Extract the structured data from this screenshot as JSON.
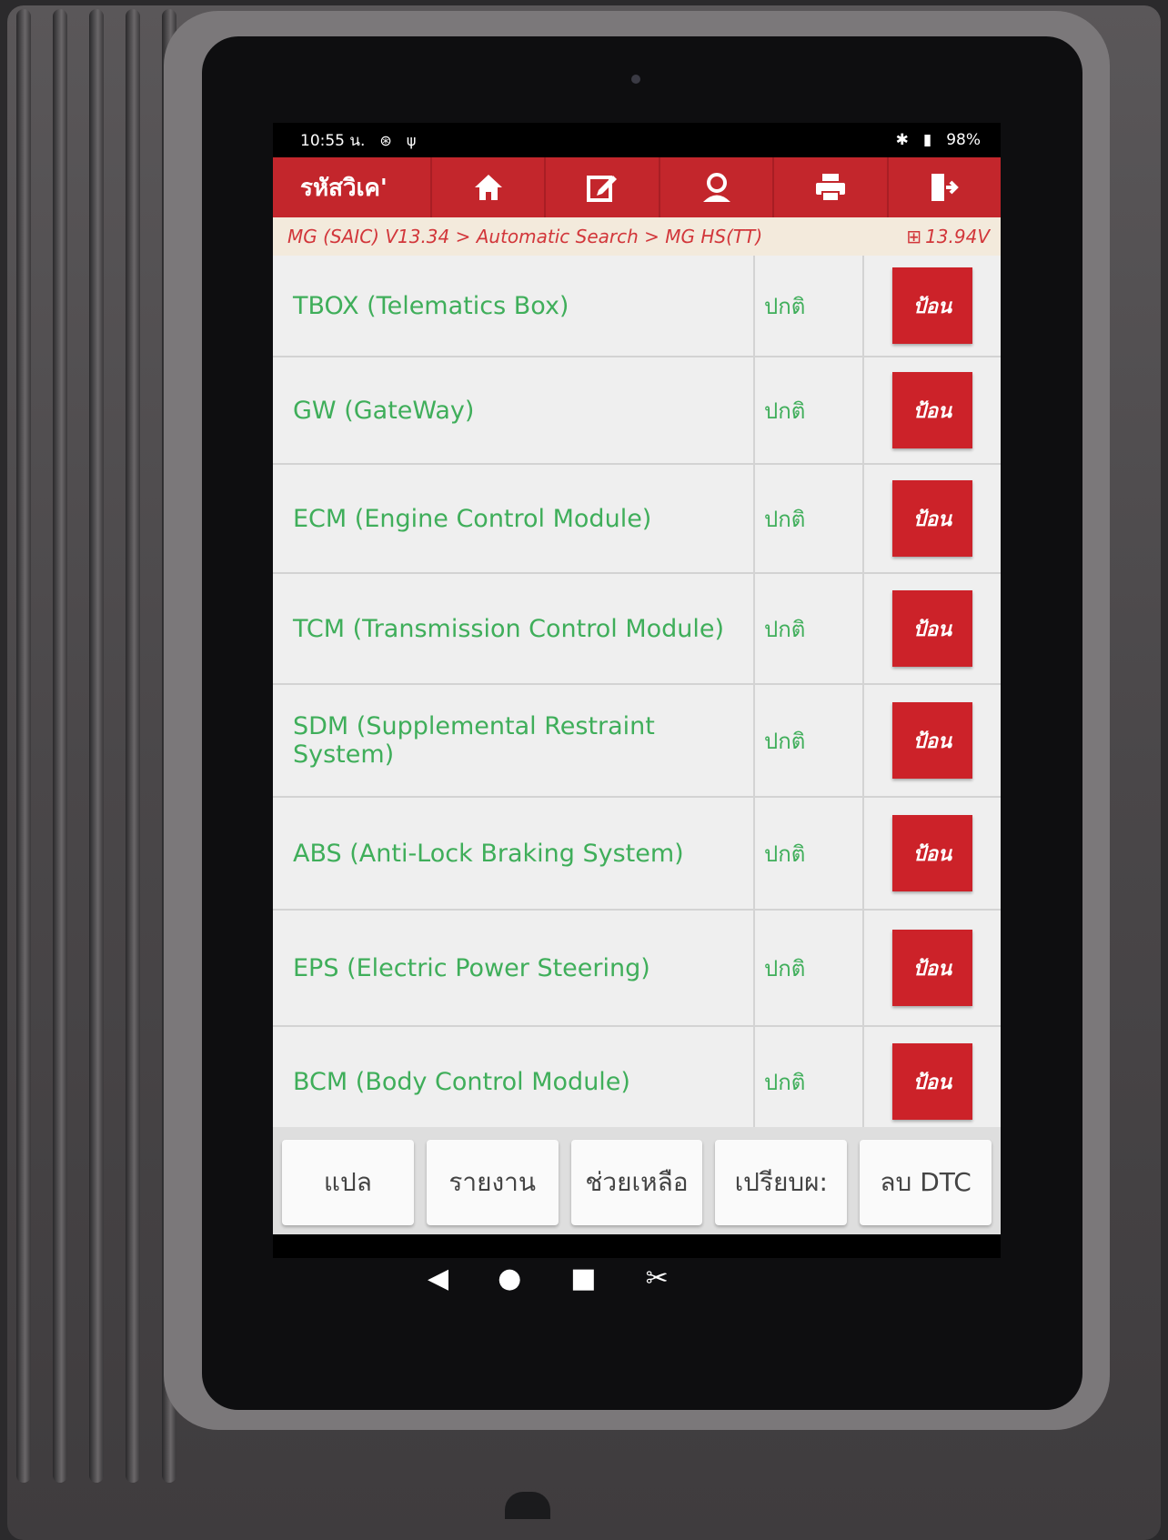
{
  "statusbar": {
    "time": "10:55 น.",
    "battery": "98%"
  },
  "toolbar": {
    "title": "รหัสวิเค'",
    "buttons": [
      "home-icon",
      "edit-icon",
      "user-icon",
      "print-icon",
      "exit-icon"
    ]
  },
  "breadcrumb": {
    "path": "MG (SAIC) V13.34 > Automatic Search > MG HS(TT)",
    "voltage": "13.94V"
  },
  "systems": [
    {
      "name": "TBOX (Telematics Box)",
      "status": "ปกติ",
      "action": "ป้อน"
    },
    {
      "name": "GW (GateWay)",
      "status": "ปกติ",
      "action": "ป้อน"
    },
    {
      "name": "ECM (Engine Control Module)",
      "status": "ปกติ",
      "action": "ป้อน"
    },
    {
      "name": "TCM (Transmission Control Module)",
      "status": "ปกติ",
      "action": "ป้อน"
    },
    {
      "name": "SDM (Supplemental Restraint System)",
      "status": "ปกติ",
      "action": "ป้อน"
    },
    {
      "name": "ABS (Anti-Lock Braking System)",
      "status": "ปกติ",
      "action": "ป้อน"
    },
    {
      "name": "EPS (Electric Power Steering)",
      "status": "ปกติ",
      "action": "ป้อน"
    },
    {
      "name": "BCM (Body Control Module)",
      "status": "ปกติ",
      "action": "ป้อน"
    }
  ],
  "bottombar": {
    "buttons": [
      "แปล",
      "รายงาน",
      "ช่วยเหลือ",
      "เปรียบผ:",
      "ลบ DTC"
    ]
  },
  "colors": {
    "accent": "#c3262c",
    "status_text": "#3fae5a"
  }
}
